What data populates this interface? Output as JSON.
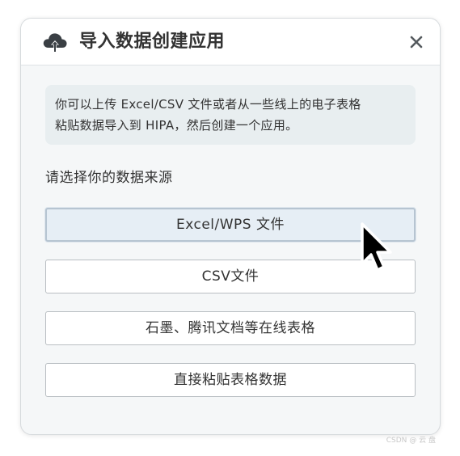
{
  "dialog": {
    "title": "导入数据创建应用",
    "close_symbol": "×",
    "icons": {
      "title_icon": "cloud-upload-icon",
      "close_icon": "close-icon"
    },
    "info_lines": [
      "你可以上传 Excel/CSV 文件或者从一些线上的电子表格",
      "粘贴数据导入到 HIPA，然后创建一个应用。"
    ],
    "source_label": "请选择你的数据来源",
    "options": [
      {
        "label": "Excel/WPS 文件",
        "active": true
      },
      {
        "label": "CSV文件",
        "active": false
      },
      {
        "label": "石墨、腾讯文档等在线表格",
        "active": false
      },
      {
        "label": "直接粘贴表格数据",
        "active": false
      }
    ]
  },
  "watermark": "CSDN @ 云 盘",
  "colors": {
    "dialog_bg": "#f5f7f8",
    "info_bg": "#e8eef0",
    "active_option_bg": "#e6eef5",
    "icon_color": "#3a3f44"
  }
}
